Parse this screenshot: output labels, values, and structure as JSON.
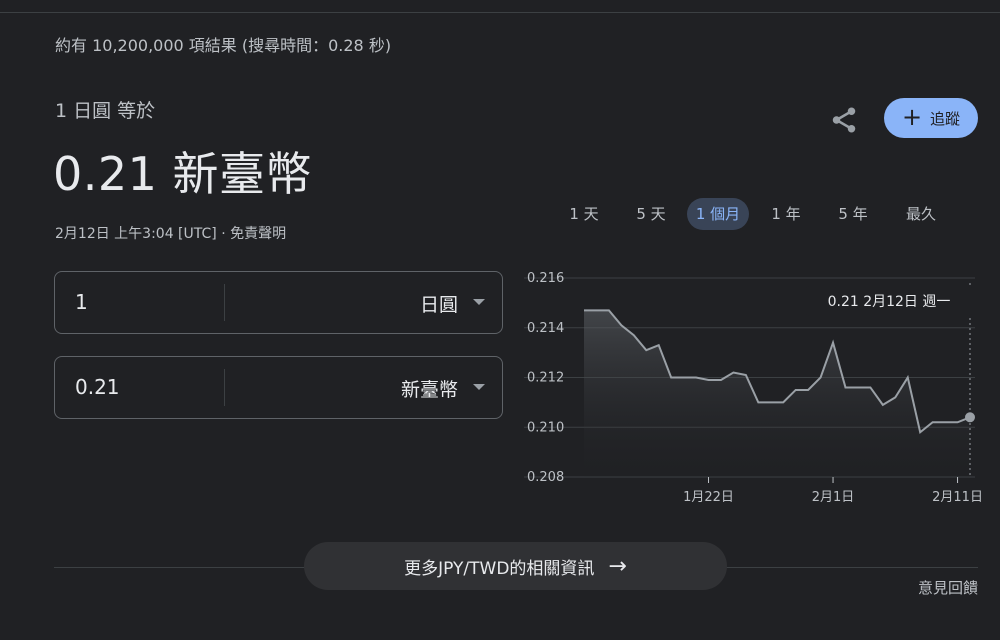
{
  "results": {
    "stats": "約有 10,200,000 項結果 (搜尋時間：0.28 秒)"
  },
  "converter": {
    "from_label": "1 日圓 等於",
    "rate_text": "0.21 新臺幣",
    "timestamp": "2月12日 上午3:04 [UTC] · 免責聲明",
    "share_icon": "share-icon",
    "follow_label": "追蹤",
    "from": {
      "amount": "1",
      "currency": "日圓"
    },
    "to": {
      "amount": "0.21",
      "currency": "新臺幣"
    }
  },
  "ranges": [
    {
      "label": "1 天",
      "active": false
    },
    {
      "label": "5 天",
      "active": false
    },
    {
      "label": "1 個月",
      "active": true
    },
    {
      "label": "1 年",
      "active": false
    },
    {
      "label": "5 年",
      "active": false
    },
    {
      "label": "最久",
      "active": false
    }
  ],
  "chart_data": {
    "type": "area",
    "ylim": [
      0.208,
      0.216
    ],
    "y_ticks": [
      "0.216",
      "0.214",
      "0.212",
      "0.210",
      "0.208"
    ],
    "x_ticks": [
      {
        "label": "1月22日",
        "index": 10
      },
      {
        "label": "2月1日",
        "index": 20
      },
      {
        "label": "2月11日",
        "index": 30
      }
    ],
    "values": [
      0.2147,
      0.2147,
      0.2147,
      0.2141,
      0.2137,
      0.2131,
      0.2133,
      0.212,
      0.212,
      0.212,
      0.2119,
      0.2119,
      0.2122,
      0.2121,
      0.211,
      0.211,
      0.211,
      0.2115,
      0.2115,
      0.212,
      0.2134,
      0.2116,
      0.2116,
      0.2116,
      0.2109,
      0.2112,
      0.212,
      0.2098,
      0.2102,
      0.2102,
      0.2102,
      0.2104
    ],
    "tooltip": "0.21  2月12日 週一",
    "colors": {
      "line": "#9aa0a6",
      "grid": "#3c4043",
      "tick": "#bdc1c6"
    }
  },
  "footer": {
    "more_info": "更多JPY/TWD的相關資訊",
    "feedback": "意見回饋"
  }
}
